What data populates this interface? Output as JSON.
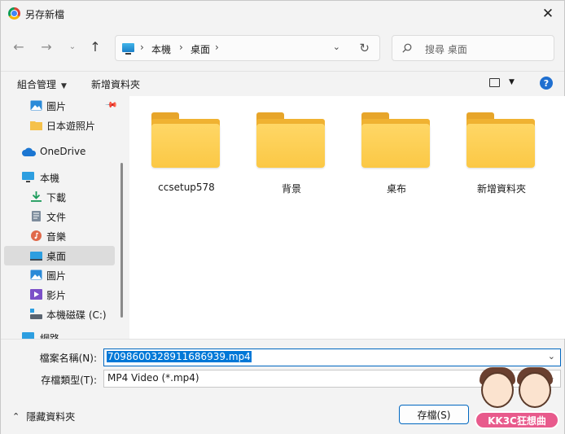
{
  "window": {
    "title": "另存新檔"
  },
  "nav": {
    "breadcrumbs": [
      "本機",
      "桌面"
    ],
    "search_placeholder": "搜尋 桌面"
  },
  "commands": {
    "organize": "組合管理",
    "new_folder": "新增資料夾"
  },
  "sidebar": {
    "items": [
      {
        "label": "圖片",
        "icon": "pictures-icon"
      },
      {
        "label": "日本遊照片",
        "icon": "folder-icon"
      },
      {
        "label": "OneDrive",
        "icon": "onedrive-icon"
      },
      {
        "label": "本機",
        "icon": "this-pc-icon"
      },
      {
        "label": "下載",
        "icon": "download-icon"
      },
      {
        "label": "文件",
        "icon": "documents-icon"
      },
      {
        "label": "音樂",
        "icon": "music-icon"
      },
      {
        "label": "桌面",
        "icon": "desktop-icon",
        "selected": true
      },
      {
        "label": "圖片",
        "icon": "pictures-icon"
      },
      {
        "label": "影片",
        "icon": "videos-icon"
      },
      {
        "label": "本機磁碟 (C:)",
        "icon": "drive-icon"
      },
      {
        "label": "網路",
        "icon": "network-icon"
      }
    ]
  },
  "folders": [
    "ccsetup578",
    "背景",
    "桌布",
    "新增資料夾"
  ],
  "form": {
    "filename_label": "檔案名稱(N):",
    "filename_value": "7098600328911686939.mp4",
    "filetype_label": "存檔類型(T):",
    "filetype_value": "MP4 Video (*.mp4)",
    "hide_folders": "隱藏資料夾",
    "save_button": "存檔(S)"
  },
  "watermark": {
    "text": "KK3C狂想曲"
  },
  "colors": {
    "accent": "#0067c0",
    "selection": "#0078d7",
    "folder": "#fbc845",
    "selected_item": "#dcdcdc"
  }
}
